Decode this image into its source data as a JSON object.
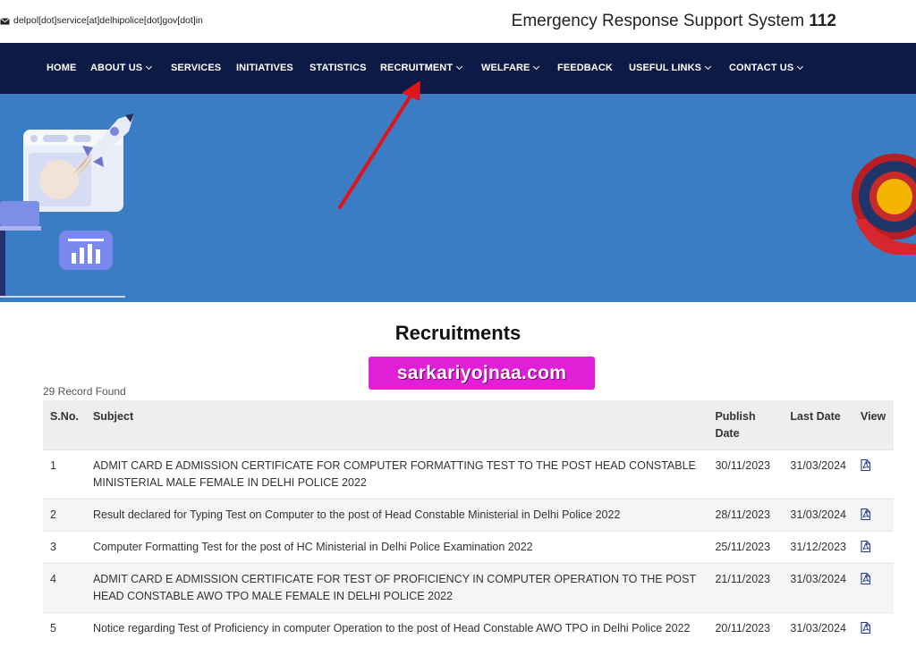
{
  "header": {
    "email": "delpol[dot]service[at]delhipolice[dot]gov[dot]in",
    "ers_text": "Emergency Response Support System",
    "ers_number": "112"
  },
  "nav": {
    "items": [
      {
        "label": "HOME",
        "dropdown": false
      },
      {
        "label": "ABOUT US",
        "dropdown": true
      },
      {
        "label": "SERVICES",
        "dropdown": false
      },
      {
        "label": "INITIATIVES",
        "dropdown": false
      },
      {
        "label": "STATISTICS",
        "dropdown": false
      },
      {
        "label": "RECRUITMENT",
        "dropdown": true
      },
      {
        "label": "WELFARE",
        "dropdown": true
      },
      {
        "label": "FEEDBACK",
        "dropdown": false
      },
      {
        "label": "USEFUL LINKS",
        "dropdown": true
      },
      {
        "label": "CONTACT US",
        "dropdown": true
      }
    ]
  },
  "page": {
    "title": "Recruitments",
    "watermark": "sarkariyojnaa.com",
    "record_count": "29 Record Found"
  },
  "table": {
    "headers": [
      "S.No.",
      "Subject",
      "Publish Date",
      "Last Date",
      "View"
    ],
    "rows": [
      {
        "sno": "1",
        "subject": "ADMIT CARD E ADMISSION CERTIFICATE FOR COMPUTER FORMATTING TEST TO THE POST HEAD CONSTABLE MINISTERIAL MALE FEMALE IN DELHI POLICE 2022",
        "publish": "30/11/2023",
        "last": "31/03/2024"
      },
      {
        "sno": "2",
        "subject": "Result declared for Typing Test on Computer to the post of Head Constable Ministerial in Delhi Police 2022",
        "publish": "28/11/2023",
        "last": "31/03/2024"
      },
      {
        "sno": "3",
        "subject": "Computer Formatting Test for the post of HC Ministerial in Delhi Police Examination 2022",
        "publish": "25/11/2023",
        "last": "31/12/2023"
      },
      {
        "sno": "4",
        "subject": "ADMIT CARD E ADMISSION CERTIFICATE FOR TEST OF PROFICIENCY IN COMPUTER OPERATION TO THE POST HEAD CONSTABLE AWO TPO MALE FEMALE IN DELHI POLICE 2022",
        "publish": "21/11/2023",
        "last": "31/03/2024"
      },
      {
        "sno": "5",
        "subject": "Notice regarding Test of Proficiency in computer Operation to the post of Head Constable AWO TPO in Delhi Police 2022",
        "publish": "20/11/2023",
        "last": "31/03/2024"
      }
    ]
  },
  "icons": {
    "email": "mail-icon",
    "view": "pdf-icon",
    "dropdown": "chevron-down-icon"
  },
  "colors": {
    "nav_bg": "#0c1a45",
    "banner_bg": "#3a7dc4",
    "watermark_bg": "#e11fd6",
    "arrow": "#e0141b",
    "pdf_icon": "#1f3a93"
  }
}
